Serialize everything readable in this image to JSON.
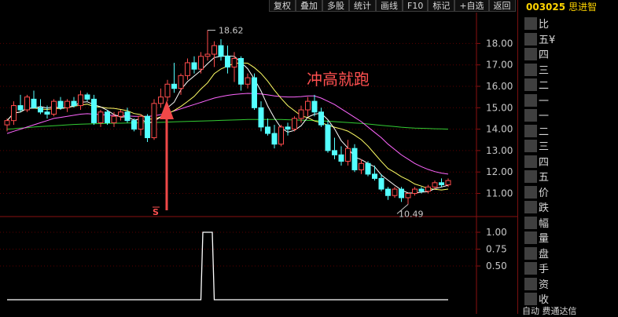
{
  "toolbar": {
    "buttons": [
      "复权",
      "叠加",
      "多股",
      "统计",
      "画线",
      "F10",
      "标记",
      "+自选",
      "返回"
    ]
  },
  "stock": {
    "code": "003025",
    "name": "思进智"
  },
  "annotation": {
    "title": "冲高就跑",
    "signal": "S"
  },
  "side_panel": {
    "labels": [
      "比",
      "五¥",
      "四",
      "三",
      "二",
      "一",
      "一",
      "二",
      "三",
      "四",
      "五",
      "价",
      "跌",
      "幅",
      "量",
      "盘",
      "手",
      "资",
      "收"
    ],
    "bottom_text": "自动    费通达信"
  },
  "colors": {
    "up": "#ff4c4c",
    "down": "#54ffff",
    "ma5": "#ffffff",
    "ma10": "#ffff66",
    "ma20": "#ff66ff",
    "ma60": "#33cc33",
    "signal": "#ff5050",
    "grid": "#5a0000",
    "axis": "#8a1010",
    "label": "#c8c8c8",
    "arrow": "#f04848"
  },
  "chart_data": [
    {
      "type": "candlestick",
      "y_ticks": [
        11.0,
        12.0,
        13.0,
        14.0,
        15.0,
        16.0,
        17.0,
        18.0
      ],
      "y_tick_labels": [
        "11.00",
        "12.00",
        "13.00",
        "14.00",
        "15.00",
        "16.00",
        "17.00",
        "18.00"
      ],
      "ylim": [
        10.0,
        19.0
      ],
      "high_label": "18.62",
      "low_label": "10.49",
      "candles": [
        [
          14.2,
          14.5,
          13.9,
          14.4
        ],
        [
          14.4,
          15.3,
          14.2,
          15.1
        ],
        [
          15.1,
          15.6,
          14.8,
          14.9
        ],
        [
          14.9,
          15.6,
          14.8,
          15.5
        ],
        [
          15.4,
          15.8,
          15.0,
          15.0
        ],
        [
          15.0,
          15.4,
          14.7,
          14.8
        ],
        [
          14.8,
          15.1,
          14.5,
          14.7
        ],
        [
          14.7,
          15.4,
          14.6,
          15.3
        ],
        [
          15.3,
          15.5,
          14.9,
          15.0
        ],
        [
          15.0,
          15.4,
          14.8,
          15.3
        ],
        [
          15.3,
          15.5,
          15.0,
          15.1
        ],
        [
          15.1,
          15.8,
          14.9,
          15.6
        ],
        [
          15.6,
          15.7,
          15.3,
          15.4
        ],
        [
          15.4,
          15.6,
          14.2,
          14.3
        ],
        [
          14.3,
          14.9,
          14.1,
          14.8
        ],
        [
          14.8,
          14.9,
          14.2,
          14.3
        ],
        [
          14.3,
          14.8,
          14.1,
          14.6
        ],
        [
          14.6,
          14.9,
          14.4,
          14.8
        ],
        [
          14.8,
          15.0,
          14.3,
          14.4
        ],
        [
          14.4,
          14.5,
          13.9,
          14.0
        ],
        [
          14.0,
          14.7,
          13.7,
          14.6
        ],
        [
          14.6,
          14.7,
          13.4,
          13.6
        ],
        [
          13.6,
          15.4,
          13.5,
          15.2
        ],
        [
          15.2,
          15.9,
          15.0,
          15.5
        ],
        [
          15.5,
          16.3,
          15.3,
          16.1
        ],
        [
          16.1,
          17.1,
          15.7,
          15.9
        ],
        [
          15.9,
          16.6,
          15.6,
          16.5
        ],
        [
          16.5,
          17.3,
          16.3,
          17.1
        ],
        [
          17.1,
          17.4,
          16.6,
          16.8
        ],
        [
          16.8,
          17.6,
          16.6,
          17.4
        ],
        [
          17.4,
          18.62,
          17.2,
          17.5
        ],
        [
          17.5,
          18.1,
          16.9,
          17.9
        ],
        [
          17.9,
          18.2,
          17.2,
          17.4
        ],
        [
          17.4,
          17.9,
          16.6,
          16.9
        ],
        [
          16.9,
          17.6,
          16.2,
          17.3
        ],
        [
          17.3,
          17.4,
          15.8,
          16.1
        ],
        [
          16.1,
          16.6,
          15.9,
          16.4
        ],
        [
          16.4,
          16.6,
          14.9,
          15.0
        ],
        [
          15.0,
          15.3,
          13.9,
          14.1
        ],
        [
          14.1,
          14.5,
          13.7,
          13.8
        ],
        [
          13.8,
          14.2,
          13.1,
          13.3
        ],
        [
          13.3,
          14.2,
          13.2,
          14.1
        ],
        [
          14.1,
          14.3,
          13.7,
          14.0
        ],
        [
          14.0,
          14.6,
          13.9,
          14.5
        ],
        [
          14.5,
          15.1,
          14.3,
          14.9
        ],
        [
          14.9,
          15.5,
          14.6,
          15.3
        ],
        [
          15.3,
          15.6,
          14.6,
          14.8
        ],
        [
          14.8,
          15.0,
          14.1,
          14.2
        ],
        [
          14.2,
          14.4,
          12.9,
          13.0
        ],
        [
          13.0,
          13.6,
          12.6,
          12.8
        ],
        [
          12.8,
          13.2,
          12.3,
          12.5
        ],
        [
          12.5,
          13.5,
          12.3,
          13.1
        ],
        [
          13.1,
          13.3,
          12.0,
          12.1
        ],
        [
          12.1,
          12.6,
          11.9,
          12.4
        ],
        [
          12.4,
          12.5,
          11.8,
          11.9
        ],
        [
          11.9,
          12.3,
          11.6,
          11.7
        ],
        [
          11.7,
          11.9,
          11.1,
          11.2
        ],
        [
          11.2,
          11.3,
          10.7,
          10.9
        ],
        [
          10.9,
          11.3,
          10.8,
          11.2
        ],
        [
          11.2,
          11.3,
          10.6,
          10.8
        ],
        [
          10.8,
          11.0,
          10.49,
          11.0
        ],
        [
          11.0,
          11.3,
          10.9,
          11.2
        ],
        [
          11.2,
          11.3,
          11.0,
          11.1
        ],
        [
          11.1,
          11.4,
          11.0,
          11.3
        ],
        [
          11.3,
          11.6,
          11.2,
          11.5
        ],
        [
          11.5,
          11.7,
          11.3,
          11.4
        ],
        [
          11.4,
          11.7,
          11.3,
          11.6
        ]
      ],
      "ma20": [
        13.8,
        13.9,
        14.0,
        14.1,
        14.2,
        14.3,
        14.4,
        14.5,
        14.55,
        14.6,
        14.65,
        14.7,
        14.72,
        14.7,
        14.68,
        14.66,
        14.64,
        14.63,
        14.62,
        14.6,
        14.6,
        14.6,
        14.62,
        14.68,
        14.75,
        14.85,
        14.95,
        15.05,
        15.15,
        15.25,
        15.35,
        15.45,
        15.52,
        15.58,
        15.62,
        15.65,
        15.67,
        15.66,
        15.64,
        15.6,
        15.55,
        15.52,
        15.5,
        15.5,
        15.52,
        15.55,
        15.55,
        15.45,
        15.3,
        15.15,
        14.95,
        14.75,
        14.55,
        14.35,
        14.1,
        13.85,
        13.6,
        13.3,
        13.05,
        12.8,
        12.6,
        12.4,
        12.25,
        12.12,
        12.02,
        11.95,
        11.9
      ],
      "ma60": [
        14.0,
        14.02,
        14.05,
        14.07,
        14.1,
        14.12,
        14.14,
        14.16,
        14.18,
        14.2,
        14.22,
        14.23,
        14.24,
        14.25,
        14.26,
        14.27,
        14.28,
        14.28,
        14.29,
        14.29,
        14.3,
        14.3,
        14.31,
        14.32,
        14.33,
        14.34,
        14.35,
        14.36,
        14.37,
        14.38,
        14.39,
        14.4,
        14.41,
        14.42,
        14.43,
        14.44,
        14.45,
        14.45,
        14.45,
        14.45,
        14.45,
        14.45,
        14.44,
        14.43,
        14.42,
        14.41,
        14.4,
        14.39,
        14.37,
        14.35,
        14.33,
        14.31,
        14.29,
        14.27,
        14.24,
        14.21,
        14.18,
        14.15,
        14.12,
        14.09,
        14.07,
        14.05,
        14.04,
        14.03,
        14.02,
        14.01,
        14.0
      ]
    },
    {
      "type": "line",
      "y_ticks": [
        0.5,
        0.75,
        1.0
      ],
      "y_tick_labels": [
        "0.50",
        "0.75",
        "1.00"
      ],
      "ylim": [
        -0.2,
        1.05
      ],
      "signal_index": 30,
      "values_note": "signal line: 0 except at the signal candle"
    }
  ]
}
